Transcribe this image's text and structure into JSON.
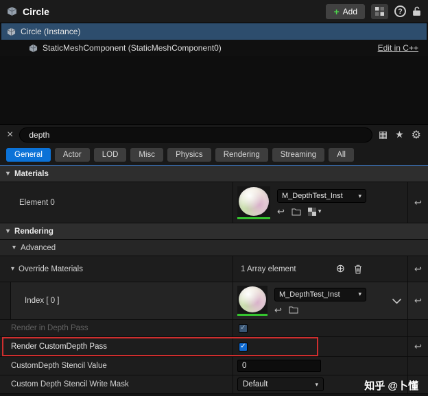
{
  "icons": {
    "plus": "+",
    "help": "?",
    "clear": "×",
    "grid": "▦",
    "star": "★",
    "gear": "⚙",
    "triangle": "▾",
    "check": "✓",
    "reset": "↩",
    "combo_arrow": "▾",
    "add_circle": "⊕",
    "use_asset": "↩"
  },
  "colors": {
    "accent_blue": "#0b72d7",
    "selection_blue": "#2d4d6d",
    "highlight_red": "#cf2e2e",
    "instance_green": "#35c42f"
  },
  "titlebar": {
    "title": "Circle",
    "add_label": "Add"
  },
  "tree": {
    "root_label": "Circle (Instance)",
    "child_label": "StaticMeshComponent (StaticMeshComponent0)",
    "edit_link": "Edit in C++"
  },
  "search": {
    "value": "depth"
  },
  "tabs": {
    "items": [
      {
        "label": "General"
      },
      {
        "label": "Actor"
      },
      {
        "label": "LOD"
      },
      {
        "label": "Misc"
      },
      {
        "label": "Physics"
      },
      {
        "label": "Rendering"
      },
      {
        "label": "Streaming"
      },
      {
        "label": "All"
      }
    ]
  },
  "materials": {
    "header": "Materials",
    "element_label": "Element 0",
    "asset_name": "M_DepthTest_Inst"
  },
  "rendering": {
    "header": "Rendering",
    "advanced_label": "Advanced",
    "override_label": "Override Materials",
    "override_value": "1 Array element",
    "index_label": "Index [ 0 ]",
    "index_asset": "M_DepthTest_Inst",
    "depth_pass_label": "Render in Depth Pass",
    "customdepth_label": "Render CustomDepth Pass",
    "stencil_label": "CustomDepth Stencil Value",
    "stencil_value": "0",
    "writemask_label": "Custom Depth Stencil Write Mask",
    "writemask_value": "Default"
  },
  "watermark": "知乎 @卜懂"
}
